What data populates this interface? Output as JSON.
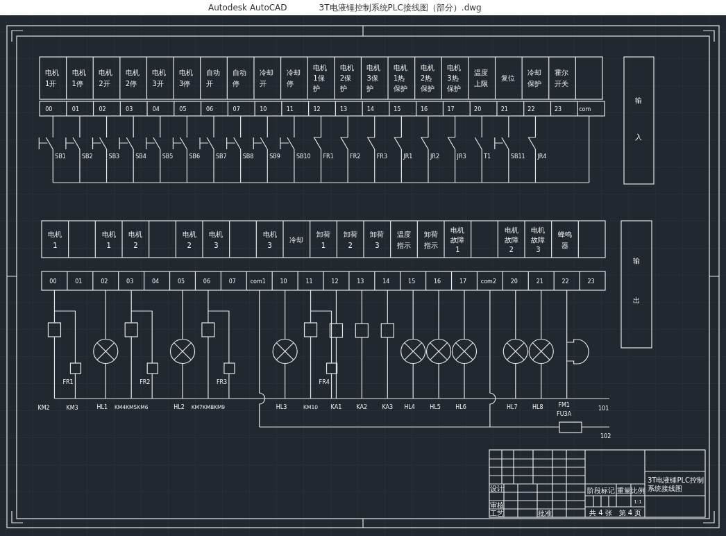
{
  "window": {
    "app": "Autodesk AutoCAD",
    "title": "3T电液锤控制系统PLC接线图（部分）.dwg"
  },
  "inputs": {
    "side_label": [
      "输",
      "入"
    ],
    "points": [
      {
        "label": [
          "电机",
          "1开"
        ],
        "address": "00",
        "switch": {
          "kind": "pushbutton",
          "tag": "SB1"
        }
      },
      {
        "label": [
          "电机",
          "1停"
        ],
        "address": "01",
        "switch": {
          "kind": "pushbutton",
          "tag": "SB2"
        }
      },
      {
        "label": [
          "电机",
          "2开"
        ],
        "address": "02",
        "switch": {
          "kind": "pushbutton",
          "tag": "SB3"
        }
      },
      {
        "label": [
          "电机",
          "2停"
        ],
        "address": "03",
        "switch": {
          "kind": "pushbutton",
          "tag": "SB4"
        }
      },
      {
        "label": [
          "电机",
          "3开"
        ],
        "address": "04",
        "switch": {
          "kind": "pushbutton",
          "tag": "SB5"
        }
      },
      {
        "label": [
          "电机",
          "3停"
        ],
        "address": "05",
        "switch": {
          "kind": "pushbutton",
          "tag": "SB6"
        }
      },
      {
        "label": [
          "自动",
          "开"
        ],
        "address": "06",
        "switch": {
          "kind": "pushbutton",
          "tag": "SB7"
        }
      },
      {
        "label": [
          "自动",
          "停"
        ],
        "address": "07",
        "switch": {
          "kind": "pushbutton",
          "tag": "SB8"
        }
      },
      {
        "label": [
          "冷却",
          "开"
        ],
        "address": "10",
        "switch": {
          "kind": "pushbutton",
          "tag": "SB9"
        }
      },
      {
        "label": [
          "冷却",
          "停"
        ],
        "address": "11",
        "switch": {
          "kind": "pushbutton",
          "tag": "SB10"
        }
      },
      {
        "label": [
          "电机",
          "1保",
          "护"
        ],
        "address": "12",
        "switch": {
          "kind": "nc",
          "tag": "FR1"
        }
      },
      {
        "label": [
          "电机",
          "2保",
          "护"
        ],
        "address": "13",
        "switch": {
          "kind": "nc",
          "tag": "FR2"
        }
      },
      {
        "label": [
          "电机",
          "3保",
          "护"
        ],
        "address": "14",
        "switch": {
          "kind": "nc",
          "tag": "FR3"
        }
      },
      {
        "label": [
          "电机",
          "1热",
          "保护"
        ],
        "address": "15",
        "switch": {
          "kind": "nc",
          "tag": "JR1"
        }
      },
      {
        "label": [
          "电机",
          "2热",
          "保护"
        ],
        "address": "16",
        "switch": {
          "kind": "nc",
          "tag": "JR2"
        }
      },
      {
        "label": [
          "电机",
          "3热",
          "保护"
        ],
        "address": "17",
        "switch": {
          "kind": "nc",
          "tag": "JR3"
        }
      },
      {
        "label": [
          "温度",
          "上限"
        ],
        "address": "20",
        "switch": {
          "kind": "no",
          "tag": "T1"
        }
      },
      {
        "label": [
          "复位"
        ],
        "address": "21",
        "switch": {
          "kind": "pushbutton",
          "tag": "SB11"
        }
      },
      {
        "label": [
          "冷却",
          "保护"
        ],
        "address": "22",
        "switch": {
          "kind": "nc",
          "tag": "JR4"
        }
      },
      {
        "label": [
          "霍尔",
          "开关"
        ],
        "address": "23"
      },
      {
        "address": "com",
        "switch": {
          "kind": "common"
        }
      }
    ]
  },
  "outputs": {
    "side_label": [
      "输",
      "出"
    ],
    "label_cells": [
      {
        "lines": [
          "电机",
          "1"
        ]
      },
      {},
      {
        "lines": [
          "电机",
          "1"
        ]
      },
      {
        "lines": [
          "电机",
          "2"
        ]
      },
      {},
      {
        "lines": [
          "电机",
          "2"
        ]
      },
      {
        "lines": [
          "电机",
          "3"
        ]
      },
      {},
      {
        "lines": [
          "电机",
          "3"
        ]
      },
      {
        "lines": [
          "冷却"
        ]
      },
      {
        "lines": [
          "卸荷",
          "1"
        ]
      },
      {
        "lines": [
          "卸荷",
          "2"
        ]
      },
      {
        "lines": [
          "卸荷",
          "3"
        ]
      },
      {
        "lines": [
          "温度",
          "指示"
        ]
      },
      {
        "lines": [
          "卸荷",
          "指示"
        ]
      },
      {
        "lines": [
          "电机",
          "故障",
          "1"
        ]
      },
      {},
      {
        "lines": [
          "电机",
          "故障",
          "2"
        ]
      },
      {
        "lines": [
          "电机",
          "故障",
          "3"
        ]
      },
      {
        "lines": [
          "蜂鸣",
          "器"
        ]
      },
      {}
    ],
    "terminals": [
      {
        "address": "00",
        "device": {
          "kind": "coil_pair",
          "tags": [
            "KM2",
            "KM3"
          ],
          "relay": "FR1"
        }
      },
      {
        "address": "01"
      },
      {
        "address": "02",
        "device": {
          "kind": "lamp",
          "tags": [
            "HL1"
          ]
        }
      },
      {
        "address": "03",
        "device": {
          "kind": "coil_pair",
          "tags": [
            "KM4KM5KM6"
          ],
          "relay": "FR2"
        }
      },
      {
        "address": "04"
      },
      {
        "address": "05",
        "device": {
          "kind": "lamp",
          "tags": [
            "HL2"
          ]
        }
      },
      {
        "address": "06",
        "device": {
          "kind": "coil_pair",
          "tags": [
            "KM7KM8KM9"
          ],
          "relay": "FR3"
        }
      },
      {
        "address": "07"
      },
      {
        "address": "com1",
        "device": {
          "kind": "common"
        }
      },
      {
        "address": "10",
        "device": {
          "kind": "lamp",
          "tags": [
            "HL3"
          ]
        }
      },
      {
        "address": "11",
        "device": {
          "kind": "coil_pair",
          "tags": [
            "KM10"
          ],
          "relay": "FR4"
        }
      },
      {
        "address": "12",
        "device": {
          "kind": "coil",
          "tags": [
            "KA1"
          ]
        }
      },
      {
        "address": "13",
        "device": {
          "kind": "coil",
          "tags": [
            "KA2"
          ]
        }
      },
      {
        "address": "14",
        "device": {
          "kind": "coil",
          "tags": [
            "KA3"
          ]
        }
      },
      {
        "address": "15",
        "device": {
          "kind": "lamp",
          "tags": [
            "HL4"
          ]
        }
      },
      {
        "address": "16",
        "device": {
          "kind": "lamp",
          "tags": [
            "HL5"
          ]
        }
      },
      {
        "address": "17",
        "device": {
          "kind": "lamp",
          "tags": [
            "HL6"
          ]
        }
      },
      {
        "address": "com2",
        "device": {
          "kind": "common"
        }
      },
      {
        "address": "20",
        "device": {
          "kind": "lamp",
          "tags": [
            "HL7"
          ]
        }
      },
      {
        "address": "21",
        "device": {
          "kind": "lamp",
          "tags": [
            "HL8"
          ]
        }
      },
      {
        "address": "22",
        "device": {
          "kind": "buzzer",
          "tags": [
            "FM1",
            "FU3A"
          ]
        }
      },
      {
        "address": "23"
      }
    ],
    "bus_labels": [
      "101",
      "102"
    ]
  },
  "title_block": {
    "designed": "设计",
    "reviewed": "审核",
    "process": "工艺",
    "approved": "批准",
    "stage_mark": "阶段标记",
    "weight": "重量",
    "scale_label": "比例",
    "scale": "1:1",
    "sheets": "共 4 张",
    "sheet": "第 4 页",
    "drawing_name": "3T电液锤PLC控制系统接线图"
  }
}
